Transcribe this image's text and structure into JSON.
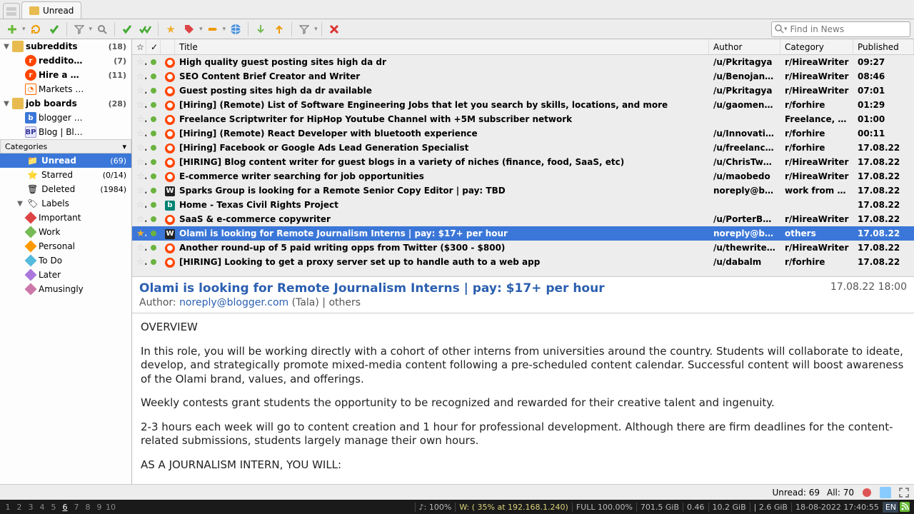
{
  "tab": {
    "label": "Unread"
  },
  "search": {
    "placeholder": "Find in News"
  },
  "sidebar": {
    "folders": [
      {
        "name": "subreddits",
        "count": "(18)",
        "bold": true,
        "icon": "folder",
        "indent": 0,
        "toggle": "▼"
      },
      {
        "name": "reddito…",
        "count": "(7)",
        "bold": true,
        "icon": "reddit",
        "indent": 1
      },
      {
        "name": "Hire a …",
        "count": "(11)",
        "bold": true,
        "icon": "reddit",
        "indent": 1
      },
      {
        "name": "Markets …",
        "count": "",
        "bold": false,
        "icon": "mkt",
        "indent": 1
      },
      {
        "name": "job boards",
        "count": "(28)",
        "bold": true,
        "icon": "folder",
        "indent": 0,
        "toggle": "▼"
      },
      {
        "name": "blogger …",
        "count": "",
        "bold": false,
        "icon": "blue",
        "indent": 1
      },
      {
        "name": "Blog | Bl…",
        "count": "",
        "bold": false,
        "icon": "bp",
        "indent": 1
      }
    ],
    "cat_header": "Categories",
    "cats": [
      {
        "name": "Unread",
        "count": "(69)",
        "sel": true,
        "icon": "📁"
      },
      {
        "name": "Starred",
        "count": "(0/14)",
        "icon": "⭐"
      },
      {
        "name": "Deleted",
        "count": "(1984)",
        "icon": "🗑"
      },
      {
        "name": "Labels",
        "count": "",
        "icon": "🏷",
        "toggle": "▼"
      }
    ],
    "labels": [
      {
        "name": "Important",
        "color": "#d44"
      },
      {
        "name": "Work",
        "color": "#7b5"
      },
      {
        "name": "Personal",
        "color": "#f90"
      },
      {
        "name": "To Do",
        "color": "#5bd"
      },
      {
        "name": "Later",
        "color": "#a7d"
      },
      {
        "name": "Amusingly",
        "color": "#c7a"
      }
    ]
  },
  "columns": {
    "title": "Title",
    "author": "Author",
    "category": "Category",
    "published": "Published"
  },
  "rows": [
    {
      "title": "High quality guest posting sites high da dr",
      "author": "/u/Pkritagya",
      "cat": "r/HireaWriter",
      "pub": "09:27",
      "icon": "reddit"
    },
    {
      "title": "SEO Content Brief Creator and Writer",
      "author": "/u/Benojango",
      "cat": "r/HireaWriter",
      "pub": "08:46",
      "icon": "reddit"
    },
    {
      "title": "Guest posting sites high da dr available",
      "author": "/u/Pkritagya",
      "cat": "r/HireaWriter",
      "pub": "07:01",
      "icon": "reddit"
    },
    {
      "title": "[Hiring] (Remote) List of Software Engineering Jobs that let you search by skills, locations, and more",
      "author": "/u/gaomeng…",
      "cat": "r/forhire",
      "pub": "01:29",
      "icon": "reddit"
    },
    {
      "title": "Freelance Scriptwriter for HipHop Youtube Channel with +5M subscriber network",
      "author": "",
      "cat": "Freelance, V…",
      "pub": "01:00",
      "icon": "reddit"
    },
    {
      "title": "[Hiring] (Remote) React Developer with bluetooth experience",
      "author": "/u/Innovativ…",
      "cat": "r/forhire",
      "pub": "00:11",
      "icon": "reddit"
    },
    {
      "title": "[Hiring] Facebook or Google Ads Lead Generation Specialist",
      "author": "/u/freelanc…",
      "cat": "r/forhire",
      "pub": "17.08.22",
      "icon": "reddit"
    },
    {
      "title": "[HIRING] Blog content writer for guest blogs in a variety of niches (finance, food, SaaS, etc)",
      "author": "/u/ChrisTwe…",
      "cat": "r/HireaWriter",
      "pub": "17.08.22",
      "icon": "reddit"
    },
    {
      "title": "E-commerce writer searching for job opportunities",
      "author": "/u/maobedo",
      "cat": "r/HireaWriter",
      "pub": "17.08.22",
      "icon": "reddit"
    },
    {
      "title": "Sparks Group is looking for a Remote Senior Copy Editor | pay: TBD",
      "author": "noreply@bl…",
      "cat": "work from h…",
      "pub": "17.08.22",
      "icon": "dark"
    },
    {
      "title": "Home - Texas Civil Rights Project",
      "author": "",
      "cat": "",
      "pub": "17.08.22",
      "icon": "bing"
    },
    {
      "title": "SaaS & e-commerce copywriter",
      "author": "/u/PorterBe…",
      "cat": "r/HireaWriter",
      "pub": "17.08.22",
      "icon": "reddit"
    },
    {
      "title": "Olami is looking for Remote Journalism Interns | pay: $17+ per hour",
      "author": "noreply@blo…",
      "cat": "others",
      "pub": "17.08.22",
      "icon": "dark",
      "sel": true,
      "star": true
    },
    {
      "title": "Another round-up of 5 paid writing opps from Twitter ($300 - $800)",
      "author": "/u/thewriter…",
      "cat": "r/HireaWriter",
      "pub": "17.08.22",
      "icon": "reddit"
    },
    {
      "title": "[HIRING] Looking to get a proxy server set up to handle auth to a web app",
      "author": "/u/dabalm",
      "cat": "r/forhire",
      "pub": "17.08.22",
      "icon": "reddit"
    }
  ],
  "article": {
    "title": "Olami is looking for Remote Journalism Interns | pay: $17+ per hour",
    "date": "17.08.22 18:00",
    "author_label": "Author: ",
    "author_email": "noreply@blogger.com",
    "author_rest": " (Tala) | others",
    "p1": "OVERVIEW",
    "p2": "In this role, you will be working directly with a cohort of other interns from universities around the country. Students will collaborate to ideate, develop, and strategically promote mixed-media content following a pre-scheduled content calendar. Successful content will boost awareness of the Olami brand, values, and offerings.",
    "p3": "Weekly contests grant students the opportunity to be recognized and rewarded for their creative talent and ingenuity.",
    "p4": "2-3 hours each week will go to content creation and 1 hour for professional development. Although there are firm deadlines for the content-related submissions, students largely manage their own hours.",
    "p5": "AS A JOURNALISM INTERN, YOU WILL:"
  },
  "status": {
    "unread": "Unread: 69",
    "all": "All: 70"
  },
  "bottom": {
    "ws": [
      "1",
      "2",
      "3",
      "4",
      "5",
      "6",
      "7",
      "8",
      "9",
      "10"
    ],
    "active": 5,
    "vol": "♪: 100%",
    "wifi": "W: ( 35% at 192.168.1.240)",
    "full": "FULL 100.00%",
    "cpu": "701.5 GiB",
    "load": "0.46",
    "mem": "10.2 GiB",
    "swap": "| 2.6 GiB",
    "date": "18-08-2022 17:40:55",
    "lang": "EN"
  }
}
